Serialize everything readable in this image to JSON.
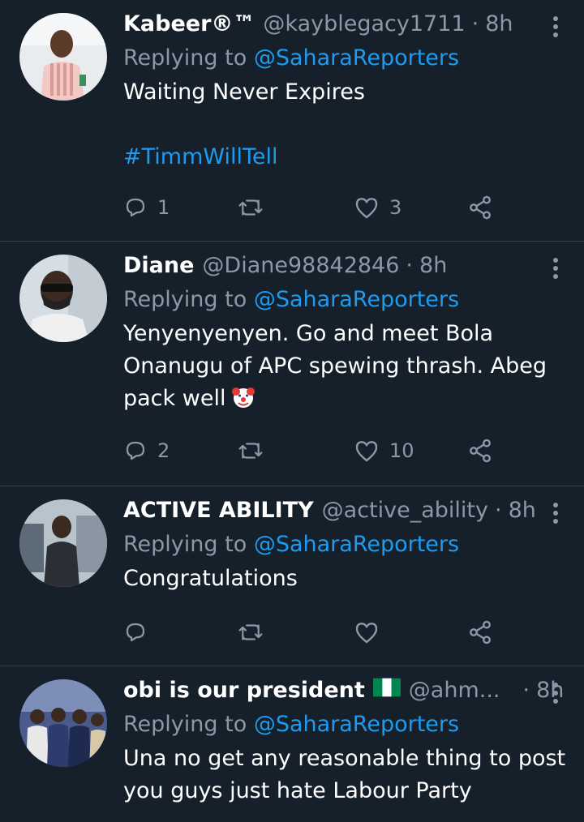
{
  "tweets": [
    {
      "name": "Kabeer®™",
      "handle": "@kayblegacy1711",
      "time": "8h",
      "replying_prefix": "Replying to ",
      "replying_to": "@SaharaReporters",
      "text": "Waiting Never Expires",
      "hashtag": "#TimmWillTell",
      "replies": "1",
      "retweets": "",
      "likes": "3"
    },
    {
      "name": "Diane",
      "handle": "@Diane98842846",
      "time": "8h",
      "replying_prefix": "Replying to ",
      "replying_to": "@SaharaReporters",
      "text": "Yenyenyenyen. Go and meet Bola Onanugu of APC spewing thrash. Abeg pack well",
      "replies": "2",
      "retweets": "",
      "likes": "10"
    },
    {
      "name": "ACTIVE ABILITY",
      "handle": "@active_ability",
      "time": "8h",
      "replying_prefix": "Replying to ",
      "replying_to": "@SaharaReporters",
      "text": "Congratulations",
      "replies": "",
      "retweets": "",
      "likes": ""
    },
    {
      "name": "obi is our president",
      "handle": "@ahm...",
      "time": "8h",
      "replying_prefix": "Replying to ",
      "replying_to": "@SaharaReporters",
      "text": "Una no get any reasonable thing to post you guys just hate Labour Party"
    }
  ],
  "separator": "·",
  "icons": [
    "reply-icon",
    "retweet-icon",
    "like-icon",
    "share-icon",
    "more-icon",
    "clown-emoji",
    "nigeria-flag"
  ],
  "colors": {
    "background": "#15202b",
    "link": "#1d9bf0",
    "muted": "#8b98a5",
    "divider": "#38444d"
  }
}
